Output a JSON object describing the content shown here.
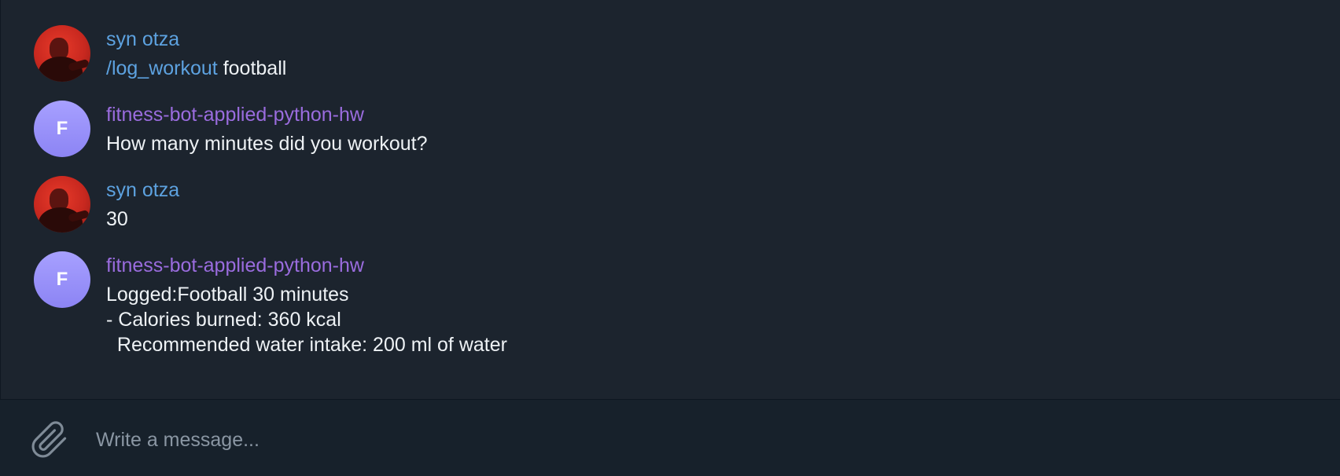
{
  "messages": [
    {
      "sender": "syn otza",
      "type": "user",
      "command": "/log_workout",
      "text": " football"
    },
    {
      "sender": "fitness-bot-applied-python-hw",
      "type": "bot",
      "avatar_letter": "F",
      "text": "How many minutes did you workout?"
    },
    {
      "sender": "syn otza",
      "type": "user",
      "text": "30"
    },
    {
      "sender": "fitness-bot-applied-python-hw",
      "type": "bot",
      "avatar_letter": "F",
      "lines": [
        "Logged:Football 30 minutes",
        "- Calories burned: 360 kcal",
        "  Recommended water intake: 200 ml of water"
      ]
    }
  ],
  "composer": {
    "placeholder": "Write a message...",
    "attach_icon": "paperclip-icon"
  },
  "colors": {
    "chat_bg": "#1c242e",
    "composer_bg": "#17212b",
    "user_name": "#5da2e0",
    "bot_name": "#9a6cde",
    "bot_avatar": "#9d96fb",
    "text": "#eef2f5",
    "placeholder": "#8a96a3"
  }
}
